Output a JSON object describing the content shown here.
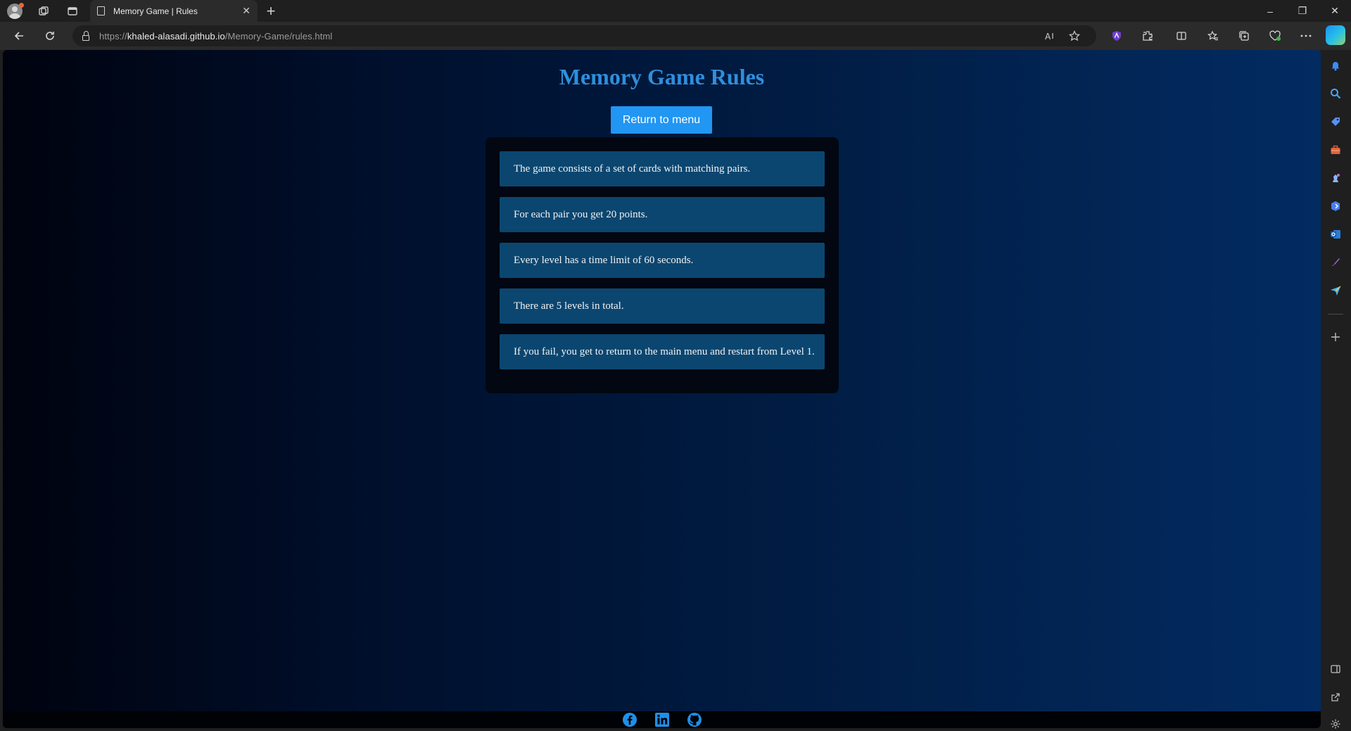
{
  "browser": {
    "tab": {
      "title": "Memory Game | Rules",
      "close": "✕"
    },
    "new_tab": "+",
    "window": {
      "minimize": "–",
      "restore": "❐",
      "close": "✕"
    },
    "url": {
      "scheme": "https://",
      "host": "khaled-alasadi.github.io",
      "path": "/Memory-Game/rules.html"
    },
    "accent": "#2196f3"
  },
  "page": {
    "title": "Memory Game Rules",
    "menu_button": "Return to menu",
    "rules": [
      "The game consists of a set of cards with matching pairs.",
      "For each pair you get 20 points.",
      "Every level has a time limit of 60 seconds.",
      "There are 5 levels in total.",
      "If you fail, you get to return to the main menu and restart from Level 1."
    ],
    "footer_links": [
      "facebook-icon",
      "linkedin-icon",
      "github-icon"
    ],
    "colors": {
      "title": "#2f8fdc",
      "button": "#2196f3",
      "rule_bg": "#0b4670",
      "panel_bg": "#020711",
      "social": "#1e90e8"
    }
  }
}
